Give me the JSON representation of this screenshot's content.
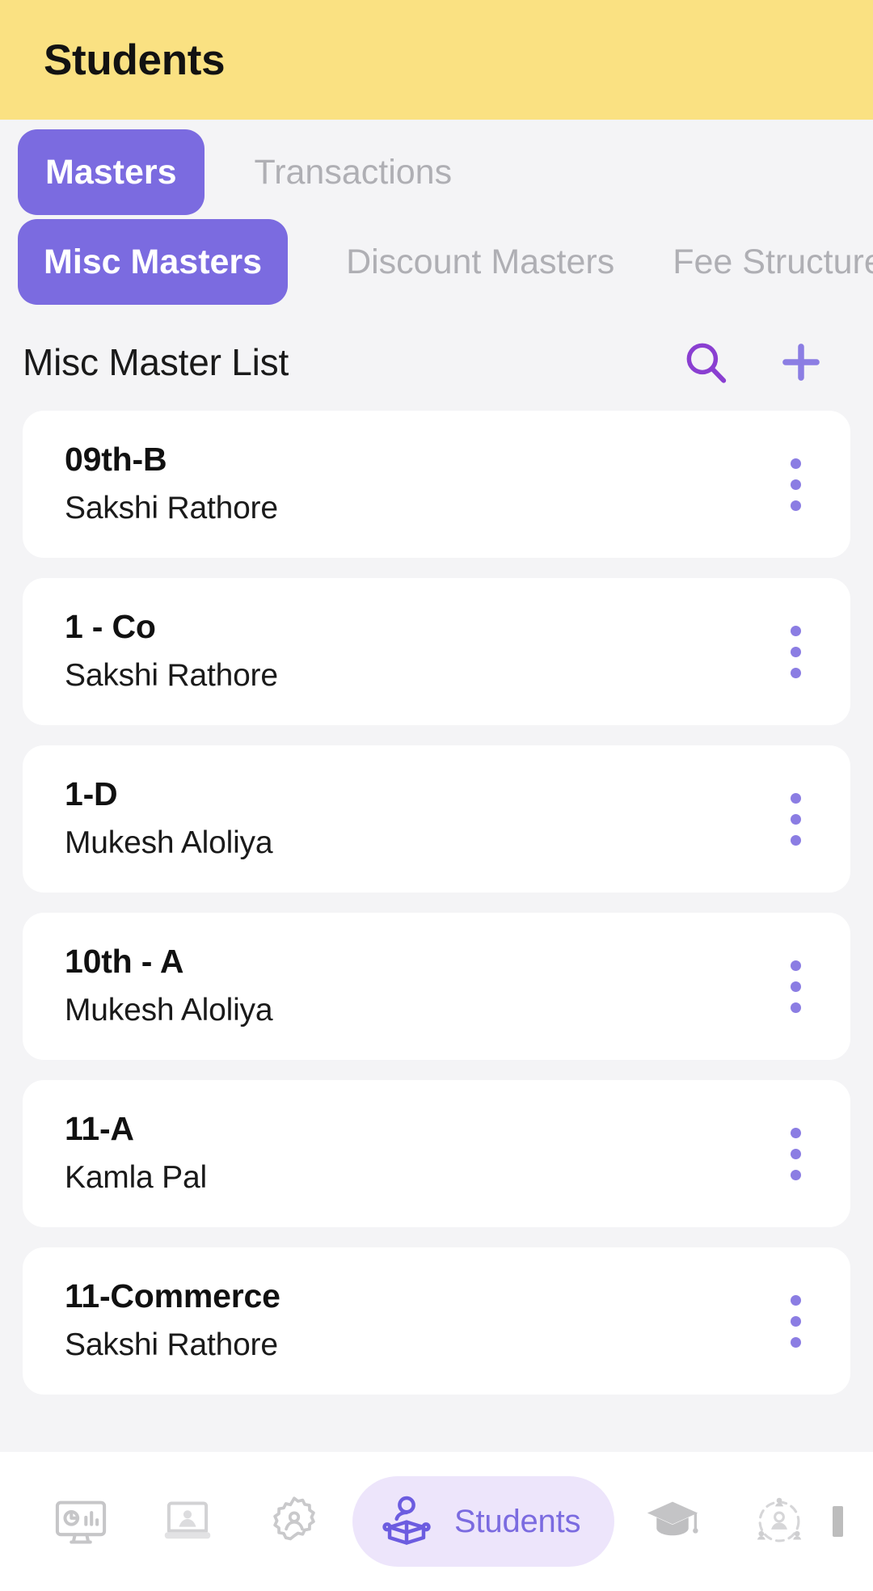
{
  "appbar": {
    "title": "Students",
    "background": "#FAE182"
  },
  "theme": {
    "accent_purple": "#7B6BE0",
    "accent_purple_light": "#8B7DE3",
    "active_pill_bg": "#EDE5FB",
    "page_bg": "#F4F4F6",
    "card_bg": "#FFFFFF",
    "inactive_tab": "#AFAFB4"
  },
  "tabs_primary": [
    {
      "label": "Masters",
      "active": true
    },
    {
      "label": "Transactions",
      "active": false
    }
  ],
  "tabs_secondary": [
    {
      "label": "Misc Masters",
      "active": true
    },
    {
      "label": "Discount Masters",
      "active": false
    },
    {
      "label": "Fee Structure",
      "active": false
    }
  ],
  "section": {
    "title": "Misc Master List",
    "search_icon": "search-icon",
    "add_icon": "plus-icon"
  },
  "list": {
    "items": [
      {
        "title": "09th-B",
        "subtitle": "Sakshi Rathore"
      },
      {
        "title": "1 - Co",
        "subtitle": "Sakshi Rathore"
      },
      {
        "title": "1-D",
        "subtitle": "Mukesh Aloliya"
      },
      {
        "title": "10th - A",
        "subtitle": "Mukesh Aloliya"
      },
      {
        "title": "11-A",
        "subtitle": "Kamla Pal"
      },
      {
        "title": "11-Commerce",
        "subtitle": "Sakshi Rathore"
      }
    ],
    "row_menu_icon": "kebab-menu-icon"
  },
  "bottom_nav": {
    "items": [
      {
        "icon": "dashboard-monitor-icon",
        "label": "",
        "active": false
      },
      {
        "icon": "laptop-elearning-icon",
        "label": "",
        "active": false
      },
      {
        "icon": "gear-user-icon",
        "label": "",
        "active": false
      },
      {
        "icon": "student-reading-icon",
        "label": "Students",
        "active": true
      },
      {
        "icon": "graduation-cap-icon",
        "label": "",
        "active": false
      },
      {
        "icon": "people-network-icon",
        "label": "",
        "active": false
      }
    ]
  }
}
